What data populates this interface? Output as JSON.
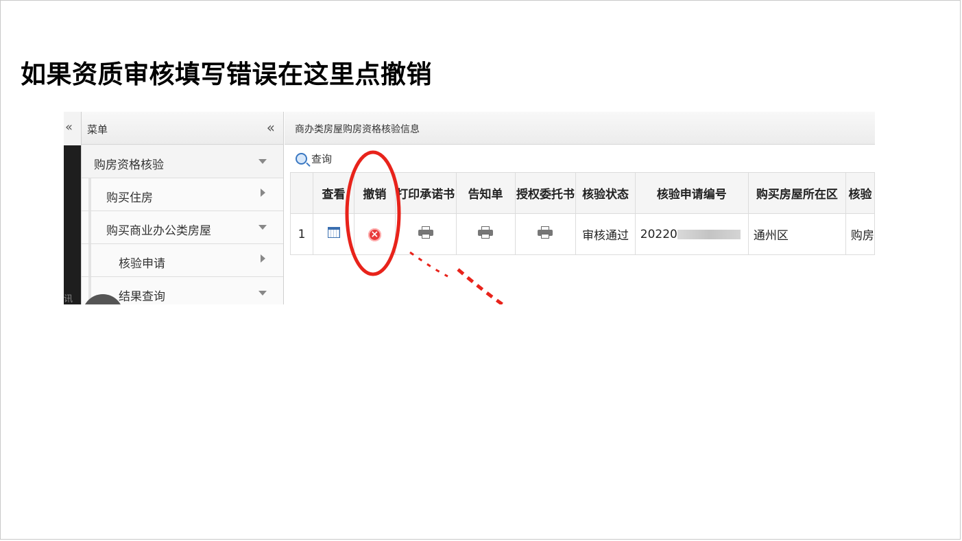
{
  "slide": {
    "title": "如果资质审核填写错误在这里点撤销"
  },
  "left_strip": {
    "collapse_glyph": "«",
    "side_char": "讯"
  },
  "menu": {
    "title": "菜单",
    "collapse_glyph": "«",
    "items": [
      {
        "label": "购房资格核验",
        "indicator": "caret-down"
      },
      {
        "label": "购买住房",
        "indicator": "caret-right"
      },
      {
        "label": "购买商业办公类房屋",
        "indicator": "caret-down"
      },
      {
        "label": "核验申请",
        "indicator": "caret-right"
      },
      {
        "label": "结果查询",
        "indicator": "caret-down"
      }
    ]
  },
  "content": {
    "title": "商办类房屋购房资格核验信息",
    "toolbar": {
      "query_label": "查询",
      "query_icon": "search-icon"
    },
    "table": {
      "headers": [
        "",
        "查看",
        "撤销",
        "打印承诺书",
        "告知单",
        "授权委托书",
        "核验状态",
        "核验申请编号",
        "购买房屋所在区",
        "核验"
      ],
      "rows": [
        {
          "index": "1",
          "view_icon": "calendar-icon",
          "cancel_icon": "cancel-icon",
          "print_promise_icon": "printer-icon",
          "notice_icon": "printer-icon",
          "authorization_icon": "printer-icon",
          "status": "审核通过",
          "application_no": "20220",
          "district": "通州区",
          "next_col": "购房"
        }
      ]
    }
  },
  "annotation": {
    "color": "#e8231b"
  }
}
